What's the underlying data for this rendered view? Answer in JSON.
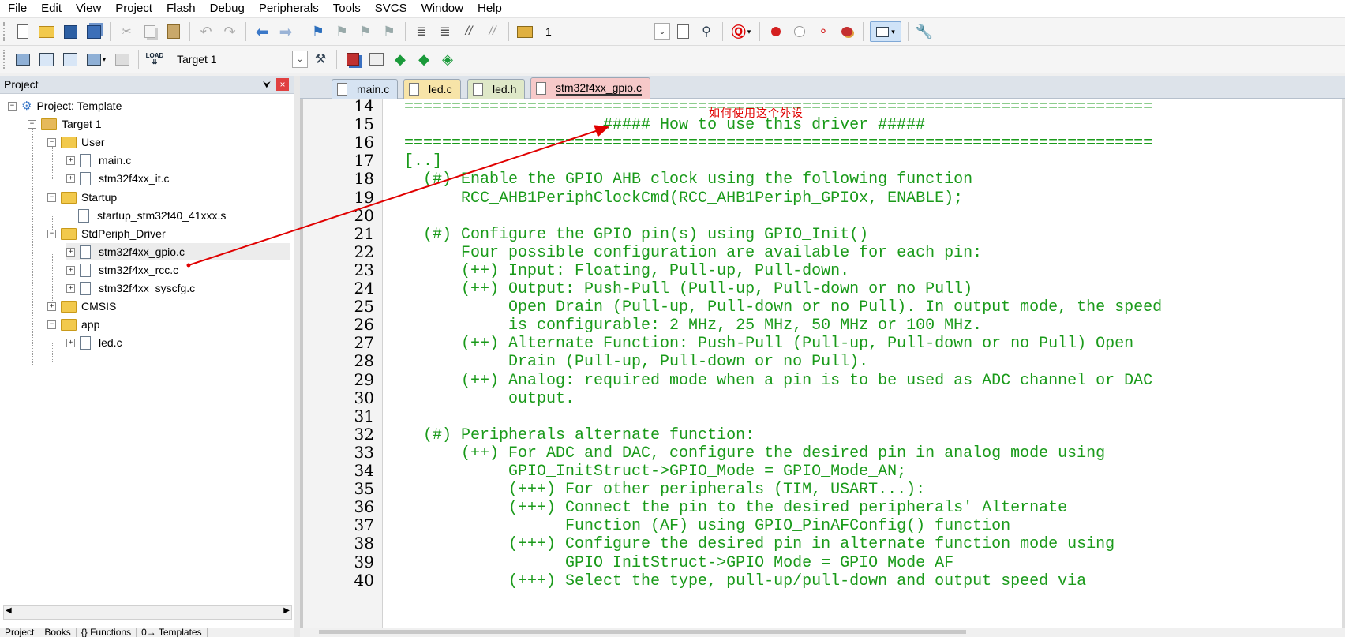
{
  "menu": [
    "File",
    "Edit",
    "View",
    "Project",
    "Flash",
    "Debug",
    "Peripherals",
    "Tools",
    "SVCS",
    "Window",
    "Help"
  ],
  "toolbar": {
    "find_value": "1",
    "target_label": "Target 1",
    "icons": [
      "new-file-icon",
      "open-icon",
      "save-icon",
      "save-all-icon",
      "cut-icon",
      "copy-icon",
      "paste-icon",
      "undo-icon",
      "redo-icon",
      "nav-back-icon",
      "nav-forward-icon",
      "bookmark-icon",
      "prev-bookmark-icon",
      "next-bookmark-icon",
      "clear-bookmarks-icon",
      "indent-icon",
      "unindent-icon",
      "comment-icon",
      "uncomment-icon",
      "find-in-files-icon"
    ]
  },
  "project_panel": {
    "title": "Project",
    "pin": "⮟",
    "close": "×",
    "tree": {
      "root": "Project: Template",
      "target": "Target 1",
      "groups": {
        "user": "User",
        "user_files": [
          "main.c",
          "stm32f4xx_it.c"
        ],
        "startup": "Startup",
        "startup_files": [
          "startup_stm32f40_41xxx.s"
        ],
        "stdperiph": "StdPeriph_Driver",
        "stdperiph_files": [
          "stm32f4xx_gpio.c",
          "stm32f4xx_rcc.c",
          "stm32f4xx_syscfg.c"
        ],
        "cmsis": "CMSIS",
        "app": "app",
        "app_files": [
          "led.c"
        ]
      }
    },
    "bottom_tabs": [
      "Project",
      "Books",
      "{} Functions",
      "0→ Templates"
    ]
  },
  "tabs": [
    {
      "label": "main.c",
      "color": "#d6e3f2"
    },
    {
      "label": "led.c",
      "color": "#f7e4a8"
    },
    {
      "label": "led.h",
      "color": "#dfe8c8"
    },
    {
      "label": "stm32f4xx_gpio.c",
      "color": "#f6c9c9"
    }
  ],
  "editor": {
    "lines": [
      {
        "n": "14",
        "text": "==============================================================================="
      },
      {
        "n": "15",
        "text": "                     ##### How to use this driver #####"
      },
      {
        "n": "16",
        "text": "==============================================================================="
      },
      {
        "n": "17",
        "text": "[..]"
      },
      {
        "n": "18",
        "text": "  (#) Enable the GPIO AHB clock using the following function"
      },
      {
        "n": "19",
        "text": "      RCC_AHB1PeriphClockCmd(RCC_AHB1Periph_GPIOx, ENABLE);"
      },
      {
        "n": "20",
        "text": ""
      },
      {
        "n": "21",
        "text": "  (#) Configure the GPIO pin(s) using GPIO_Init()"
      },
      {
        "n": "22",
        "text": "      Four possible configuration are available for each pin:"
      },
      {
        "n": "23",
        "text": "      (++) Input: Floating, Pull-up, Pull-down."
      },
      {
        "n": "24",
        "text": "      (++) Output: Push-Pull (Pull-up, Pull-down or no Pull)"
      },
      {
        "n": "25",
        "text": "           Open Drain (Pull-up, Pull-down or no Pull). In output mode, the speed"
      },
      {
        "n": "26",
        "text": "           is configurable: 2 MHz, 25 MHz, 50 MHz or 100 MHz."
      },
      {
        "n": "27",
        "text": "      (++) Alternate Function: Push-Pull (Pull-up, Pull-down or no Pull) Open"
      },
      {
        "n": "28",
        "text": "           Drain (Pull-up, Pull-down or no Pull)."
      },
      {
        "n": "29",
        "text": "      (++) Analog: required mode when a pin is to be used as ADC channel or DAC"
      },
      {
        "n": "30",
        "text": "           output."
      },
      {
        "n": "31",
        "text": ""
      },
      {
        "n": "32",
        "text": "  (#) Peripherals alternate function:"
      },
      {
        "n": "33",
        "text": "      (++) For ADC and DAC, configure the desired pin in analog mode using"
      },
      {
        "n": "34",
        "text": "           GPIO_InitStruct->GPIO_Mode = GPIO_Mode_AN;"
      },
      {
        "n": "35",
        "text": "           (+++) For other peripherals (TIM, USART...):"
      },
      {
        "n": "36",
        "text": "           (+++) Connect the pin to the desired peripherals' Alternate"
      },
      {
        "n": "37",
        "text": "                 Function (AF) using GPIO_PinAFConfig() function"
      },
      {
        "n": "38",
        "text": "           (+++) Configure the desired pin in alternate function mode using"
      },
      {
        "n": "39",
        "text": "                 GPIO_InitStruct->GPIO_Mode = GPIO_Mode_AF"
      },
      {
        "n": "40",
        "text": "           (+++) Select the type, pull-up/pull-down and output speed via"
      }
    ],
    "text_color": "#1a9a1a"
  },
  "annotation": {
    "text": "如何使用这个外设",
    "color": "#e00000"
  }
}
